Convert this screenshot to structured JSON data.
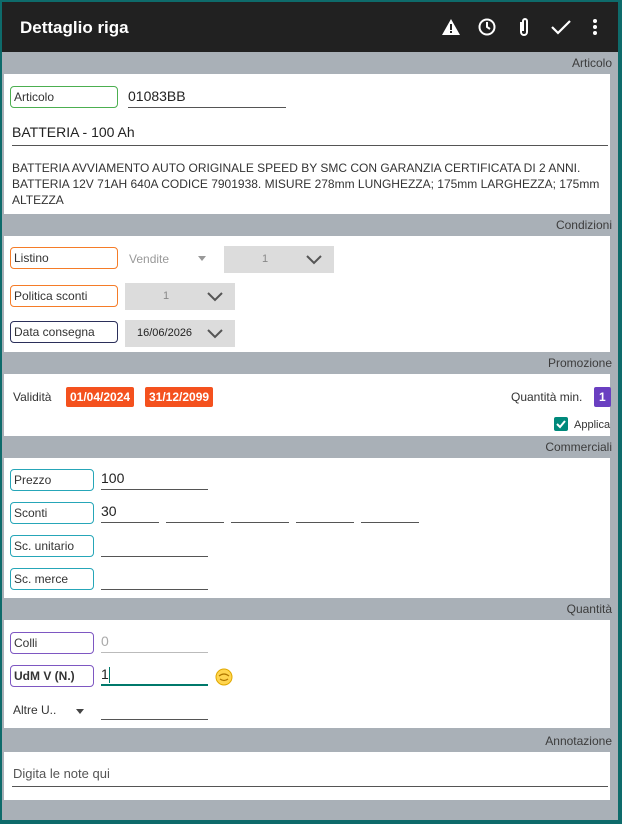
{
  "appbar": {
    "title": "Dettaglio riga"
  },
  "articolo": {
    "header": "Articolo",
    "label": "Articolo",
    "code": "01083BB",
    "name": "BATTERIA - 100 Ah",
    "description": "BATTERIA AVVIAMENTO AUTO ORIGINALE SPEED BY SMC CON GARANZIA CERTIFICATA DI 2 ANNI. BATTERIA 12V 71AH 640A CODICE 7901938. MISURE 278mm LUNGHEZZA; 175mm LARGHEZZA; 175mm ALTEZZA"
  },
  "condizioni": {
    "header": "Condizioni",
    "listino_label": "Listino",
    "listino_value": "Vendite",
    "listino_num": "1",
    "politica_label": "Politica sconti",
    "politica_value": "1",
    "data_label": "Data consegna",
    "data_value": "16/06/2026"
  },
  "promozione": {
    "header": "Promozione",
    "validita_label": "Validità",
    "date_from": "01/04/2024",
    "date_to": "31/12/2099",
    "qty_label": "Quantità min.",
    "qty_value": "1",
    "applica_label": "Applica",
    "applica_checked": true
  },
  "commerciali": {
    "header": "Commerciali",
    "prezzo_label": "Prezzo",
    "prezzo_value": "100",
    "sconti_label": "Sconti",
    "sconti_values": [
      "30",
      "",
      "",
      "",
      ""
    ],
    "unitario_label": "Sc. unitario",
    "unitario_value": "",
    "merce_label": "Sc. merce",
    "merce_value": ""
  },
  "quantita": {
    "header": "Quantità",
    "colli_label": "Colli",
    "colli_value": "0",
    "udm_label": "UdM V (N.)",
    "udm_value": "1",
    "altre_label": "Altre U..",
    "altre_value": ""
  },
  "annotazione": {
    "header": "Annotazione",
    "placeholder": "Digita le note qui"
  },
  "colors": {
    "appbar": "#212121",
    "badge": "#f4511e",
    "qty_badge": "#6a3fc1",
    "check": "#00897b"
  }
}
